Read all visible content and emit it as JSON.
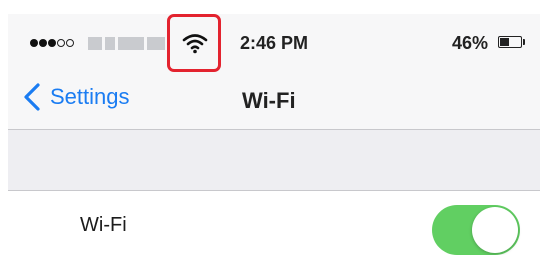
{
  "status_bar": {
    "signal_bars": {
      "filled": 3,
      "total": 5
    },
    "carrier_label": "blurred",
    "time": "2:46 PM",
    "battery_percent": "46%",
    "battery_level": 0.46,
    "wifi_icon": "wifi-icon",
    "highlight_color": "#e3232f"
  },
  "nav_bar": {
    "back_label": "Settings",
    "back_icon": "chevron-left-icon",
    "title": "Wi-Fi",
    "accent_color": "#1a7cf2"
  },
  "settings": {
    "wifi_row": {
      "label": "Wi-Fi",
      "toggle_on": true,
      "toggle_color": "#61cf62"
    }
  }
}
